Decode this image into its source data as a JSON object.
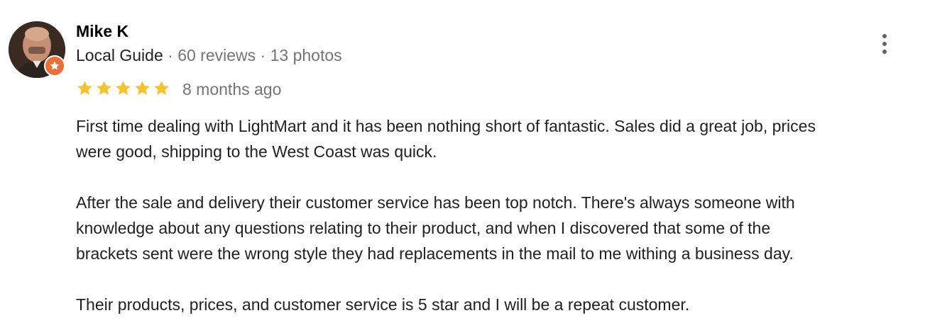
{
  "review": {
    "author": "Mike K",
    "role": "Local Guide",
    "separator": " · ",
    "reviews_count": "60 reviews",
    "photos_count": "13 photos",
    "rating": 5,
    "max_rating": 5,
    "time_ago": "8 months ago",
    "paragraphs": [
      "First time dealing with LightMart and it has been nothing short of fantastic. Sales did a great job, prices\nwere good, shipping to the West Coast was quick.",
      "After the sale and delivery their customer service has been top notch. There's always someone with\nknowledge about any questions relating to their product, and when I discovered that some of the\nbrackets sent were the wrong style they had replacements in the mail to me withing a business day.",
      "Their products, prices, and customer service is 5 star and I will be a repeat customer."
    ]
  },
  "icons": {
    "badge": "local-guide-star-icon",
    "more": "more-vert-icon",
    "star": "star-icon"
  },
  "colors": {
    "star": "#f4c430",
    "badge": "#e8703a",
    "muted_text": "#70757a",
    "text": "#202124"
  }
}
